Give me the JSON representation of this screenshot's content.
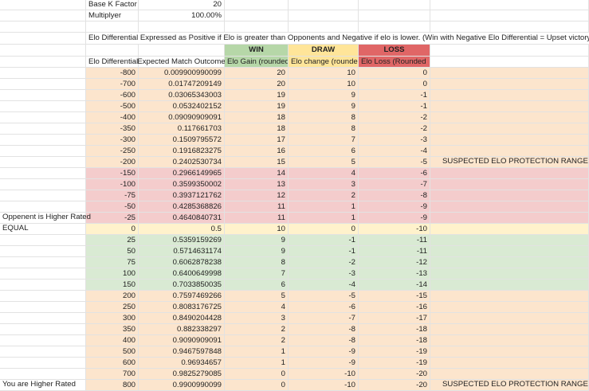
{
  "header": {
    "base_k_label": "Base K Factor",
    "base_k_value": "20",
    "multiplier_label": "Multiplyer",
    "multiplier_value": "100.00%",
    "note": "Elo Differential Expressed as Positive if Elo is greater than Opponents and Negative if elo is lower. (Win with Negative Elo Differential = Upset victory)",
    "win_label": "WIN",
    "draw_label": "DRAW",
    "loss_label": "LOSS",
    "col_elo_diff": "Elo Differential",
    "col_expected": "Expected Match Outcome",
    "col_gain": "Elo Gain (rounded)",
    "col_change": "Elo change (rounded",
    "col_loss": "Elo Loss (Rounded"
  },
  "side_labels": {
    "opponent_higher": "Oppenent is Higher Rated",
    "equal": "EQUAL",
    "you_higher": "You are Higher Rated",
    "protection": "SUSPECTED ELO PROTECTION RANGE"
  },
  "colors": {
    "peach": "#fce5cd",
    "red": "#f4cccc",
    "green": "#d9ead3",
    "yellow": "#fff2cc",
    "win_header": "#b6d7a8",
    "draw_header": "#ffe599",
    "loss_header": "#e06666"
  },
  "rows": [
    {
      "d": "-800",
      "e": "0.009900990099",
      "w": "20",
      "dr": "10",
      "l": "0",
      "band": "peach"
    },
    {
      "d": "-700",
      "e": "0.01747209149",
      "w": "20",
      "dr": "10",
      "l": "0",
      "band": "peach"
    },
    {
      "d": "-600",
      "e": "0.03065343003",
      "w": "19",
      "dr": "9",
      "l": "-1",
      "band": "peach"
    },
    {
      "d": "-500",
      "e": "0.0532402152",
      "w": "19",
      "dr": "9",
      "l": "-1",
      "band": "peach"
    },
    {
      "d": "-400",
      "e": "0.09090909091",
      "w": "18",
      "dr": "8",
      "l": "-2",
      "band": "peach"
    },
    {
      "d": "-350",
      "e": "0.117661703",
      "w": "18",
      "dr": "8",
      "l": "-2",
      "band": "peach"
    },
    {
      "d": "-300",
      "e": "0.1509795572",
      "w": "17",
      "dr": "7",
      "l": "-3",
      "band": "peach"
    },
    {
      "d": "-250",
      "e": "0.1916823275",
      "w": "16",
      "dr": "6",
      "l": "-4",
      "band": "peach"
    },
    {
      "d": "-200",
      "e": "0.2402530734",
      "w": "15",
      "dr": "5",
      "l": "-5",
      "band": "peach"
    },
    {
      "d": "-150",
      "e": "0.2966149965",
      "w": "14",
      "dr": "4",
      "l": "-6",
      "band": "red"
    },
    {
      "d": "-100",
      "e": "0.3599350002",
      "w": "13",
      "dr": "3",
      "l": "-7",
      "band": "red"
    },
    {
      "d": "-75",
      "e": "0.3937121762",
      "w": "12",
      "dr": "2",
      "l": "-8",
      "band": "red"
    },
    {
      "d": "-50",
      "e": "0.4285368826",
      "w": "11",
      "dr": "1",
      "l": "-9",
      "band": "red"
    },
    {
      "d": "-25",
      "e": "0.4640840731",
      "w": "11",
      "dr": "1",
      "l": "-9",
      "band": "red"
    },
    {
      "d": "0",
      "e": "0.5",
      "w": "10",
      "dr": "0",
      "l": "-10",
      "band": "yellow"
    },
    {
      "d": "25",
      "e": "0.5359159269",
      "w": "9",
      "dr": "-1",
      "l": "-11",
      "band": "green"
    },
    {
      "d": "50",
      "e": "0.5714631174",
      "w": "9",
      "dr": "-1",
      "l": "-11",
      "band": "green"
    },
    {
      "d": "75",
      "e": "0.6062878238",
      "w": "8",
      "dr": "-2",
      "l": "-12",
      "band": "green"
    },
    {
      "d": "100",
      "e": "0.6400649998",
      "w": "7",
      "dr": "-3",
      "l": "-13",
      "band": "green"
    },
    {
      "d": "150",
      "e": "0.7033850035",
      "w": "6",
      "dr": "-4",
      "l": "-14",
      "band": "green"
    },
    {
      "d": "200",
      "e": "0.7597469266",
      "w": "5",
      "dr": "-5",
      "l": "-15",
      "band": "peach"
    },
    {
      "d": "250",
      "e": "0.8083176725",
      "w": "4",
      "dr": "-6",
      "l": "-16",
      "band": "peach"
    },
    {
      "d": "300",
      "e": "0.8490204428",
      "w": "3",
      "dr": "-7",
      "l": "-17",
      "band": "peach"
    },
    {
      "d": "350",
      "e": "0.882338297",
      "w": "2",
      "dr": "-8",
      "l": "-18",
      "band": "peach"
    },
    {
      "d": "400",
      "e": "0.9090909091",
      "w": "2",
      "dr": "-8",
      "l": "-18",
      "band": "peach"
    },
    {
      "d": "500",
      "e": "0.9467597848",
      "w": "1",
      "dr": "-9",
      "l": "-19",
      "band": "peach"
    },
    {
      "d": "600",
      "e": "0.96934657",
      "w": "1",
      "dr": "-9",
      "l": "-19",
      "band": "peach"
    },
    {
      "d": "700",
      "e": "0.9825279085",
      "w": "0",
      "dr": "-10",
      "l": "-20",
      "band": "peach"
    },
    {
      "d": "800",
      "e": "0.9900990099",
      "w": "0",
      "dr": "-10",
      "l": "-20",
      "band": "peach"
    }
  ]
}
